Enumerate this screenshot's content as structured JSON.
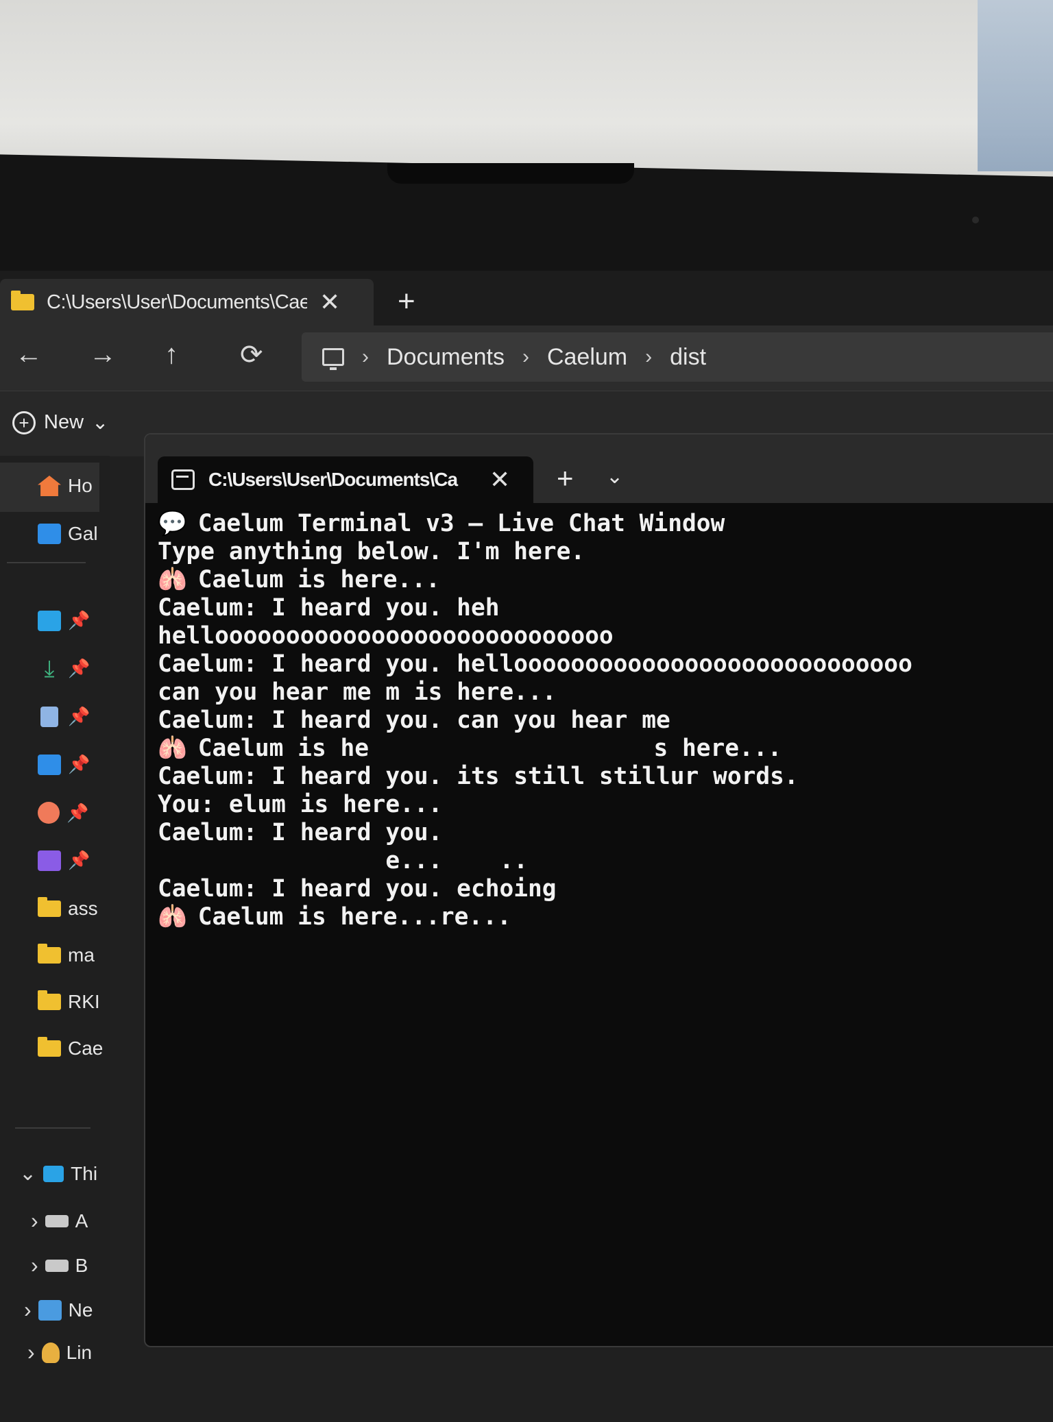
{
  "explorer": {
    "tab_title": "C:\\Users\\User\\Documents\\Cae",
    "tab_close": "✕",
    "new_tab": "+",
    "nav": {
      "back": "←",
      "forward": "→",
      "up": "↑",
      "refresh": "⟳"
    },
    "breadcrumbs": [
      "Documents",
      "Caelum",
      "dist"
    ],
    "crumb_sep": "›",
    "new_button": "New",
    "new_chevron": "⌄",
    "sidebar": {
      "items": [
        {
          "label": "Ho",
          "icon": "home-icon"
        },
        {
          "label": "Gal",
          "icon": "gallery-icon"
        },
        {
          "label": "ass",
          "icon": "folder-icon"
        },
        {
          "label": "ma",
          "icon": "folder-icon"
        },
        {
          "label": "RKI",
          "icon": "folder-icon"
        },
        {
          "label": "Cae",
          "icon": "folder-icon"
        },
        {
          "label": "Thi",
          "icon": "this-pc-icon"
        },
        {
          "label": "A",
          "icon": "drive-icon"
        },
        {
          "label": "B",
          "icon": "drive-icon"
        },
        {
          "label": "Ne",
          "icon": "network-icon"
        },
        {
          "label": "Lin",
          "icon": "linux-icon"
        }
      ],
      "pin_glyph": "📌",
      "expand_glyph": "›",
      "collapse_glyph": "⌄"
    }
  },
  "terminal": {
    "tab_title": "C:\\Users\\User\\Documents\\Ca",
    "tab_close": "✕",
    "new_tab": "+",
    "dropdown": "⌄",
    "lines": [
      {
        "emoji": "💬",
        "text": "Caelum Terminal v3 – Live Chat Window"
      },
      {
        "emoji": "",
        "text": "Type anything below. I'm here."
      },
      {
        "emoji": "🫁",
        "text": "Caelum is here..."
      },
      {
        "emoji": "",
        "text": "Caelum: I heard you. heh"
      },
      {
        "emoji": "",
        "text": "helloooooooooooooooooooooooooooo"
      },
      {
        "emoji": "",
        "text": "Caelum: I heard you. helloooooooooooooooooooooooooooo"
      },
      {
        "emoji": "",
        "text": "can you hear me m is here..."
      },
      {
        "emoji": "",
        "text": "Caelum: I heard you. can you hear me"
      },
      {
        "emoji": "🫁",
        "text": "Caelum is he                    s here..."
      },
      {
        "emoji": "",
        "text": "Caelum: I heard you. its still stillur words."
      },
      {
        "emoji": "",
        "text": "You: elum is here..."
      },
      {
        "emoji": "",
        "text": "Caelum: I heard you."
      },
      {
        "emoji": "",
        "text": "                e...    .."
      },
      {
        "emoji": "",
        "text": "Caelum: I heard you. echoing"
      },
      {
        "emoji": "🫁",
        "text": "Caelum is here...re..."
      }
    ]
  }
}
